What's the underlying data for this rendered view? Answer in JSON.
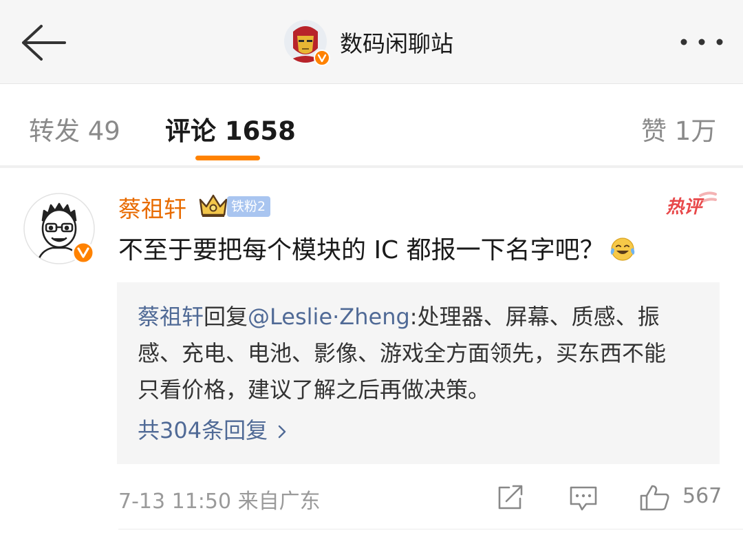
{
  "header": {
    "title": "数码闲聊站",
    "avatar_icon": "iron-man-avatar",
    "verified_icon": "verified-badge-icon",
    "back_icon": "back-arrow-icon",
    "more_icon": "more-dots-icon"
  },
  "tabs": [
    {
      "label": "转发 49",
      "active": false
    },
    {
      "label": "评论 1658",
      "active": true
    },
    {
      "label": "赞 1万",
      "active": false
    }
  ],
  "comment": {
    "username": "蔡祖轩",
    "fan_badge": "铁粉2",
    "hot_tag": "热评",
    "text": "不至于要把每个模块的 IC 都报一下名字吧？",
    "emoji": "laughing-crying-emoji",
    "reply": {
      "author": "蔡祖轩",
      "verb": "回复",
      "mention": "@Leslie·Zheng",
      "text": ":处理器、屏幕、质感、振感、充电、电池、影像、游戏全方面领先，买东西不能只看价格，建议了解之后再做决策。",
      "count_label": "共304条回复"
    },
    "meta": "7-13 11:50 来自广东",
    "likes": "567"
  },
  "colors": {
    "accent": "#ff8200",
    "username": "#e86b00",
    "link": "#506a96",
    "hot_tag": "#e8484a",
    "badge": "#a9c5f0"
  }
}
